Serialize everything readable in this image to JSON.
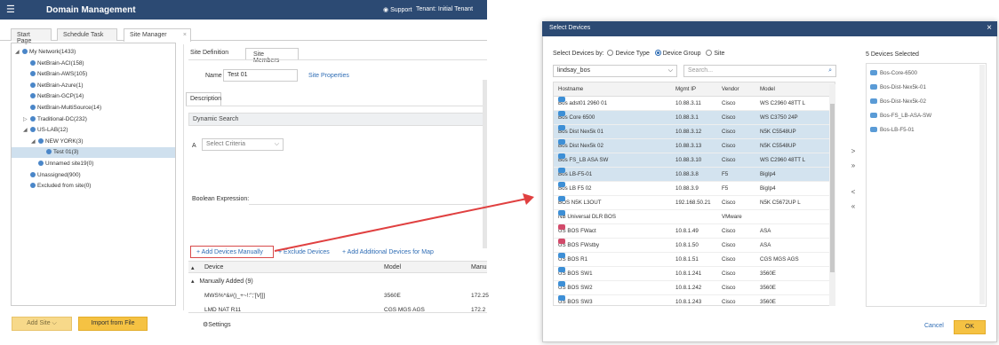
{
  "app": {
    "title": "Domain Management",
    "support": "Support",
    "tenant": "Tenant: Initial Tenant"
  },
  "tabs": [
    "Start Page",
    "Schedule Task",
    "Site Manager"
  ],
  "tree": [
    {
      "label": "My Network(1433)",
      "indent": 0,
      "caret": "◢",
      "selected": false
    },
    {
      "label": "NetBrain-ACI(158)",
      "indent": 1,
      "caret": "",
      "selected": false
    },
    {
      "label": "NetBrain-AWS(105)",
      "indent": 1,
      "caret": "",
      "selected": false
    },
    {
      "label": "NetBrain-Azure(1)",
      "indent": 1,
      "caret": "",
      "selected": false
    },
    {
      "label": "NetBrain-GCP(14)",
      "indent": 1,
      "caret": "",
      "selected": false
    },
    {
      "label": "NetBrain-MultiSource(14)",
      "indent": 1,
      "caret": "",
      "selected": false
    },
    {
      "label": "Traditional-DC(232)",
      "indent": 1,
      "caret": "▷",
      "selected": false
    },
    {
      "label": "US-LAB(12)",
      "indent": 1,
      "caret": "◢",
      "selected": false
    },
    {
      "label": "NEW YORK(3)",
      "indent": 2,
      "caret": "◢",
      "selected": false
    },
    {
      "label": "Test 01(3)",
      "indent": 3,
      "caret": "",
      "selected": true
    },
    {
      "label": "Unnamed site19(0)",
      "indent": 2,
      "caret": "",
      "selected": false
    },
    {
      "label": "Unassigned(900)",
      "indent": 1,
      "caret": "",
      "selected": false
    },
    {
      "label": "Excluded from site(0)",
      "indent": 1,
      "caret": "",
      "selected": false
    }
  ],
  "left_footer": {
    "add_site": "Add Site",
    "import": "Import from File"
  },
  "site": {
    "subtabs": [
      "Site Definition",
      "Site Members"
    ],
    "name_label": "Name",
    "name_value": "Test 01",
    "site_properties": "Site Properties",
    "description_tab": "Description",
    "dynamic_search": "Dynamic Search",
    "criteria_prefix": "A",
    "criteria_placeholder": "Select Criteria",
    "boolean_label": "Boolean Expression:",
    "actions": [
      "+ Add Devices Manually",
      "+ Exclude Devices",
      "+ Add Additional Devices for Map"
    ],
    "grid_headers": [
      "Device",
      "Model",
      "Manu"
    ],
    "group_label": "Manually Added (9)",
    "rows": [
      {
        "device": "MWS%*&#()_+~!:\";'[V[]]",
        "model": "3560E",
        "manu": "172.25"
      },
      {
        "device": "LMD NAT R11",
        "model": "CGS MGS AGS",
        "manu": "172.2"
      }
    ],
    "settings": "Settings"
  },
  "dialog": {
    "title": "Select Devices",
    "select_by": "Select Devices by:",
    "options": [
      "Device Type",
      "Device Group",
      "Site"
    ],
    "selected_option": 1,
    "group_value": "lindsay_bos",
    "search_placeholder": "Search...",
    "columns": [
      "Hostname",
      "Mgmt IP",
      "Vendor",
      "Model"
    ],
    "rows": [
      {
        "host": "Bos adst01 2960 01",
        "ip": "10.88.3.11",
        "vendor": "Cisco",
        "model": "WS C2960 48TT L",
        "sel": false
      },
      {
        "host": "Bos Core 6500",
        "ip": "10.88.3.1",
        "vendor": "Cisco",
        "model": "WS C3750 24P",
        "sel": true
      },
      {
        "host": "Bos Dist Nex5k 01",
        "ip": "10.88.3.12",
        "vendor": "Cisco",
        "model": "N5K C5548UP",
        "sel": true
      },
      {
        "host": "Bos Dist Nex5k 02",
        "ip": "10.88.3.13",
        "vendor": "Cisco",
        "model": "N5K C5548UP",
        "sel": true
      },
      {
        "host": "Bos FS_LB ASA SW",
        "ip": "10.88.3.10",
        "vendor": "Cisco",
        "model": "WS C2960 48TT L",
        "sel": true
      },
      {
        "host": "Bos LB-F5-01",
        "ip": "10.88.3.8",
        "vendor": "F5",
        "model": "BigIp4",
        "sel": true
      },
      {
        "host": "Bos LB F5 02",
        "ip": "10.88.3.9",
        "vendor": "F5",
        "model": "BigIp4",
        "sel": false
      },
      {
        "host": "BOS N5K L3OUT",
        "ip": "192.168.50.21",
        "vendor": "Cisco",
        "model": "N5K C5672UP L",
        "sel": false
      },
      {
        "host": "NB Universal DLR BOS",
        "ip": "",
        "vendor": "VMware",
        "model": "",
        "sel": false
      },
      {
        "host": "US BOS FWact",
        "ip": "10.8.1.49",
        "vendor": "Cisco",
        "model": "ASA",
        "sel": false
      },
      {
        "host": "US BOS FWstby",
        "ip": "10.8.1.50",
        "vendor": "Cisco",
        "model": "ASA",
        "sel": false
      },
      {
        "host": "US BOS R1",
        "ip": "10.8.1.51",
        "vendor": "Cisco",
        "model": "CGS MGS AGS",
        "sel": false
      },
      {
        "host": "US BOS SW1",
        "ip": "10.8.1.241",
        "vendor": "Cisco",
        "model": "3560E",
        "sel": false
      },
      {
        "host": "US BOS SW2",
        "ip": "10.8.1.242",
        "vendor": "Cisco",
        "model": "3560E",
        "sel": false
      },
      {
        "host": "US BOS SW3",
        "ip": "10.8.1.243",
        "vendor": "Cisco",
        "model": "3560E",
        "sel": false
      }
    ],
    "selected_title": "5 Devices Selected",
    "selected": [
      "Bos-Core-6500",
      "Bos-Dist-Nex5k-01",
      "Bos-Dist-Nex5k-02",
      "Bos-FS_LB-ASA-SW",
      "Bos-LB-F5-01"
    ],
    "move": [
      ">",
      "»",
      "<",
      "«"
    ],
    "cancel": "Cancel",
    "ok": "OK"
  }
}
